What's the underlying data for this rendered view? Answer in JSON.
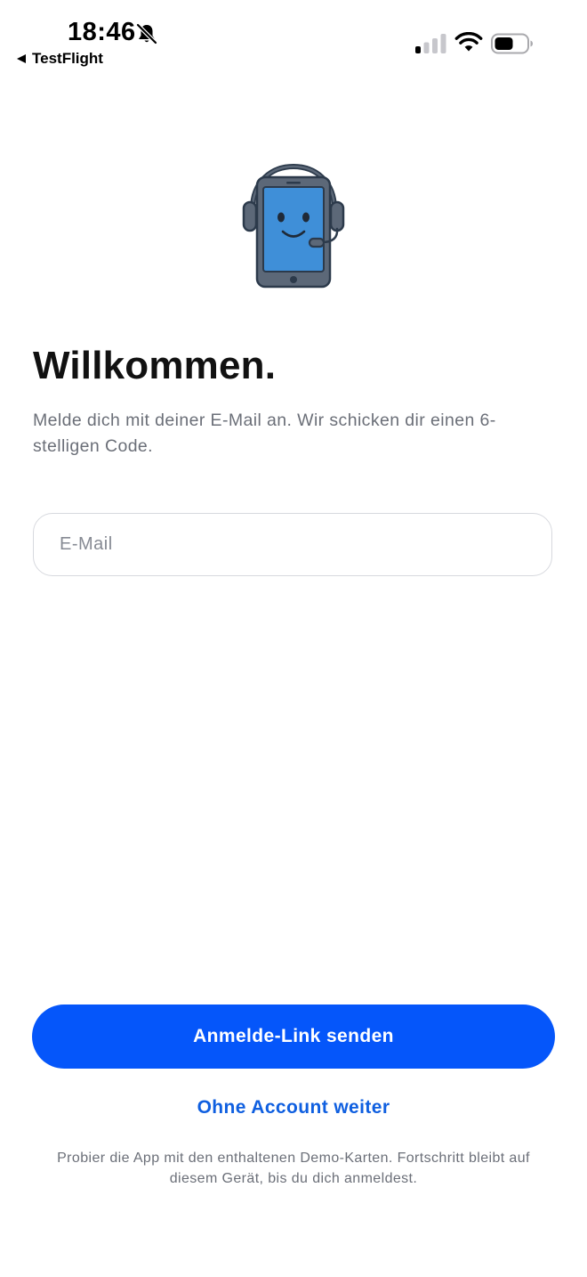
{
  "status_bar": {
    "time": "18:46",
    "back_app_label": "TestFlight",
    "icons": [
      "bell-off-icon",
      "back-arrow-icon",
      "cellular-signal-icon",
      "wifi-icon",
      "battery-icon"
    ]
  },
  "illustration": {
    "icon": "phone-with-headset-icon",
    "colors": {
      "screen": "#3f8fd8",
      "body": "#5c6878",
      "outline": "#2c3a4b"
    }
  },
  "login": {
    "title": "Willkommen.",
    "subtitle": "Melde dich mit deiner E-Mail an. Wir schicken dir einen 6-stelligen Code.",
    "email_placeholder": "E-Mail",
    "email_value": "",
    "primary_button": "Anmelde-Link senden",
    "secondary_link": "Ohne Account weiter",
    "footnote": "Probier die App mit den enthaltenen Demo-Karten. Fortschritt bleibt auf diesem Gerät, bis du dich anmeldest."
  },
  "colors": {
    "accent": "#0556fa",
    "link": "#0f5fe0",
    "muted_text": "#6b6f78"
  }
}
